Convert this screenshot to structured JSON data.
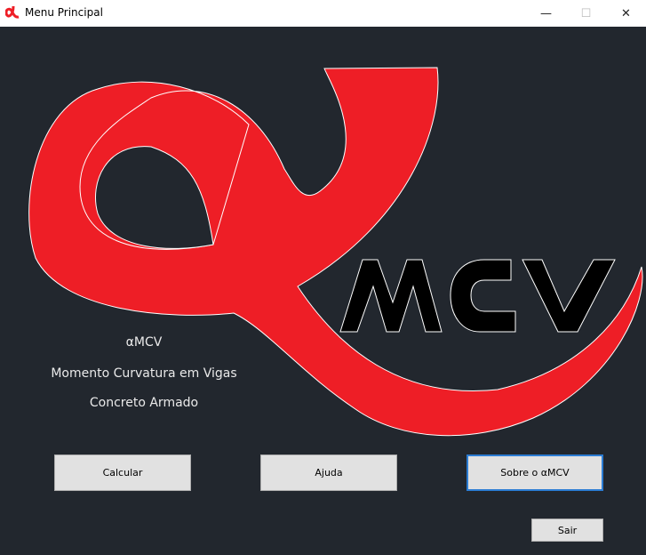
{
  "window": {
    "title": "Menu Principal",
    "controls": {
      "minimize": "—",
      "maximize": "☐",
      "close": "✕"
    }
  },
  "logo": {
    "text": "MCV",
    "alpha_color": "#ee1e26",
    "letters_color": "#000000"
  },
  "labels": {
    "app_name": "αMCV",
    "line1": "Momento Curvatura em Vigas",
    "line2": "Concreto Armado"
  },
  "buttons": {
    "calcular": "Calcular",
    "ajuda": "Ajuda",
    "sobre": "Sobre o αMCV",
    "sair": "Sair"
  },
  "colors": {
    "background": "#22272e",
    "accent_focus": "#2b7cd3"
  }
}
